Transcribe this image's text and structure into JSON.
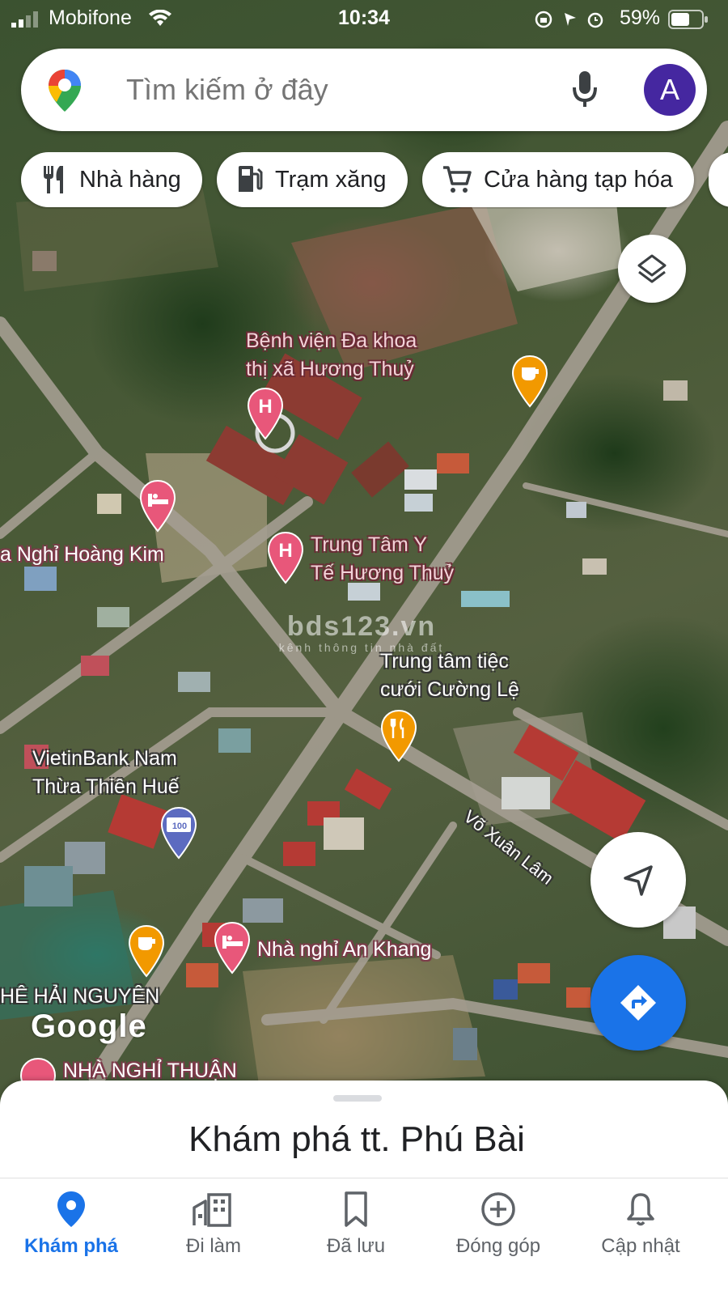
{
  "status_bar": {
    "carrier": "Mobifone",
    "time": "10:34",
    "battery": "59%"
  },
  "search": {
    "placeholder": "Tìm kiếm ở đây",
    "avatar_letter": "A"
  },
  "chips": [
    {
      "label": "Nhà hàng",
      "icon": "restaurant-icon"
    },
    {
      "label": "Trạm xăng",
      "icon": "gas-station-icon"
    },
    {
      "label": "Cửa hàng tạp hóa",
      "icon": "shopping-cart-icon"
    }
  ],
  "map": {
    "places": {
      "hospital_main_line1": "Bệnh viện Đa khoa",
      "hospital_main_line2": "thị xã Hương Thuỷ",
      "health_center_line1": "Trung Tâm Y",
      "health_center_line2": "Tế Hương Thuỷ",
      "guesthouse_hoang_kim": "a Nghỉ Hoàng Kim",
      "wedding_center_line1": "Trung tâm tiệc",
      "wedding_center_line2": "cưới Cường Lệ",
      "vietinbank_line1": "VietinBank Nam",
      "vietinbank_line2": "Thừa Thiên Huế",
      "guesthouse_an_khang": "Nhà nghỉ An Khang",
      "hai_nguyen": "HÊ HẢI NGUYÊN",
      "guesthouse_thuan": "NHÀ NGHỈ THUẬN"
    },
    "street": "Võ Xuân Lâm",
    "bank_badge": "100",
    "watermark_title": "bds123.vn",
    "watermark_subtitle": "kênh thông tin nhà đất",
    "logo": "Google"
  },
  "sheet": {
    "title": "Khám phá tt. Phú Bài"
  },
  "nav": [
    {
      "label": "Khám phá",
      "icon": "explore-pin-icon",
      "active": true
    },
    {
      "label": "Đi làm",
      "icon": "commute-building-icon",
      "active": false
    },
    {
      "label": "Đã lưu",
      "icon": "bookmark-icon",
      "active": false
    },
    {
      "label": "Đóng góp",
      "icon": "add-circle-icon",
      "active": false
    },
    {
      "label": "Cập nhật",
      "icon": "bell-icon",
      "active": false
    }
  ],
  "colors": {
    "accent": "#1a73e8",
    "avatar_bg": "#4527a0",
    "poi_pink": "#e8577a",
    "poi_orange": "#f29900"
  }
}
